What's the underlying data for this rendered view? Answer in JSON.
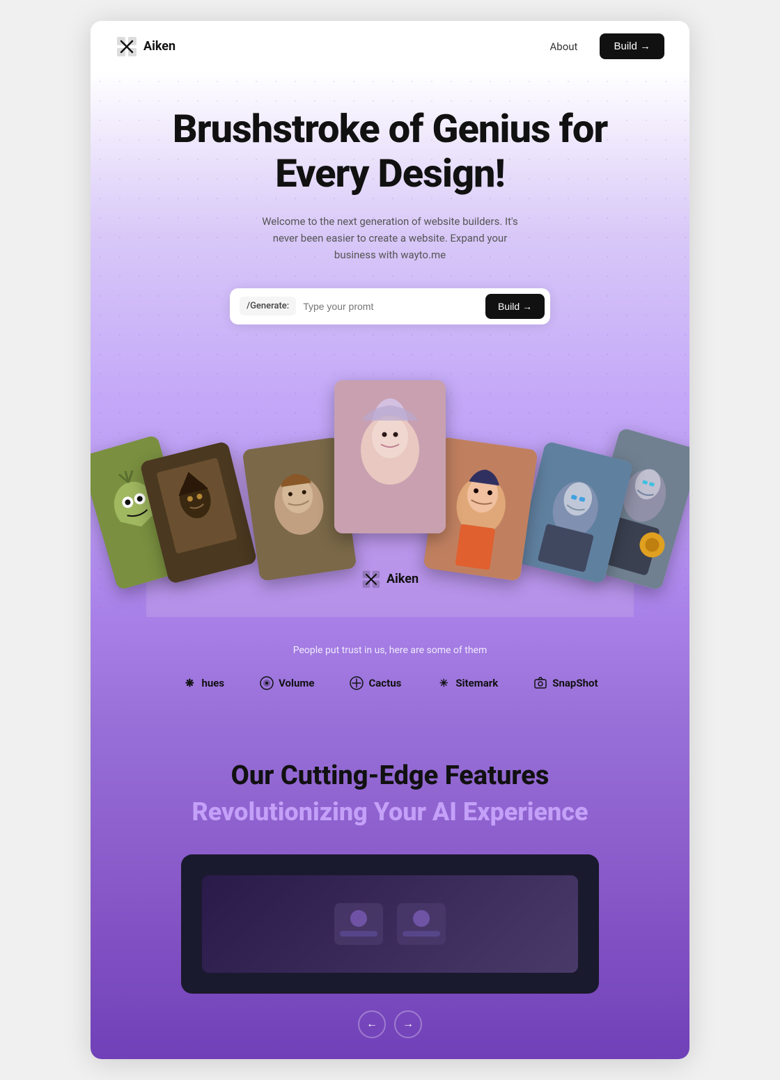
{
  "page": {
    "title": "Aiken - Brushstroke of Genius for Every Design"
  },
  "header": {
    "logo_text": "Aiken",
    "nav_about": "About",
    "nav_build": "Build →"
  },
  "hero": {
    "title_line1": "Brushstroke of Genius for",
    "title_line2": "Every Design!",
    "subtitle": "Welcome to the next generation of website builders. It's never been easier to create a website. Expand your business with wayto.me",
    "generate_label": "/Generate:",
    "generate_placeholder": "Type your promt",
    "generate_btn": "Build →"
  },
  "brand_watermark": "Aiken",
  "trust": {
    "heading": "People put trust in us, here are some of them",
    "logos": [
      {
        "name": "hues",
        "icon": "❋",
        "label": "hues"
      },
      {
        "name": "volume",
        "icon": "🎵",
        "label": "Volume"
      },
      {
        "name": "cactus",
        "icon": "⊕",
        "label": "Cactus"
      },
      {
        "name": "sitemark",
        "icon": "✳",
        "label": "Sitemark"
      },
      {
        "name": "snapshot",
        "icon": "📷",
        "label": "SnapShot"
      }
    ]
  },
  "features": {
    "title": "Our Cutting-Edge Features",
    "subtitle": "Revolutionizing Your AI Experience"
  },
  "nav_prev": "←",
  "nav_next": "→"
}
